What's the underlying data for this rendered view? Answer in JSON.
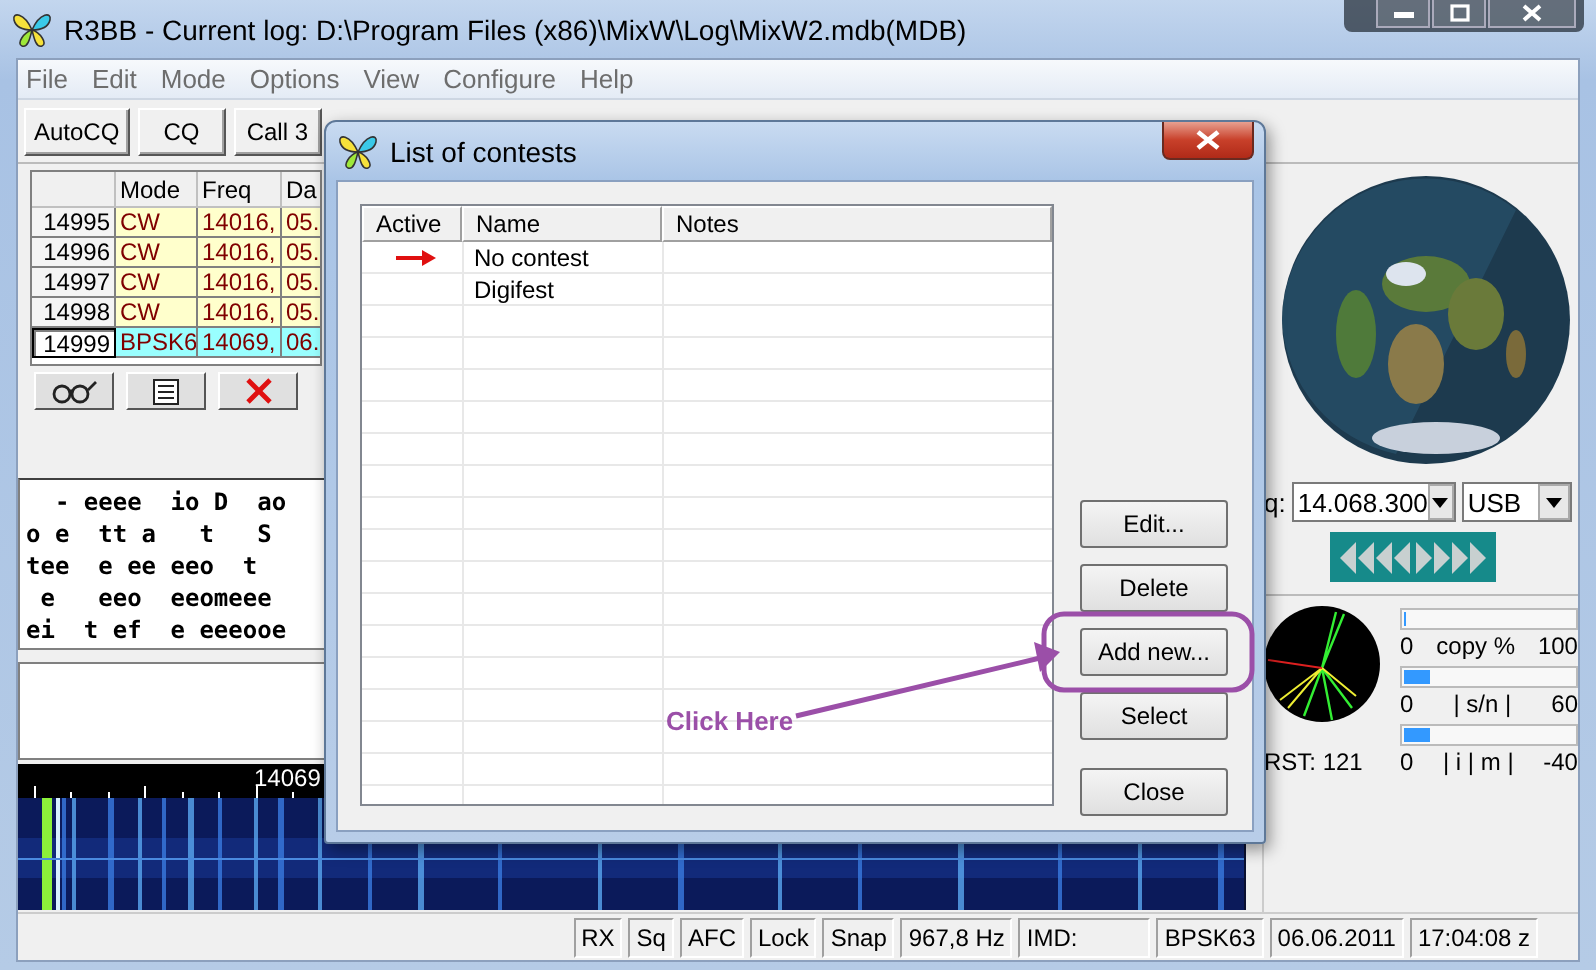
{
  "window": {
    "title": "R3BB - Current log: D:\\Program Files (x86)\\MixW\\Log\\MixW2.mdb(MDB)"
  },
  "menu": [
    "File",
    "Edit",
    "Mode",
    "Options",
    "View",
    "Configure",
    "Help"
  ],
  "toolbar": [
    "AutoCQ",
    "CQ",
    "Call 3"
  ],
  "log": {
    "columns": [
      "Mode",
      "Freq",
      "Da"
    ],
    "rows": [
      {
        "number": "14995",
        "mode": "CW",
        "freq": "14016,",
        "date": "05.",
        "color": "#ffffcc",
        "selected": false
      },
      {
        "number": "14996",
        "mode": "CW",
        "freq": "14016,",
        "date": "05.",
        "color": "#ffffcc",
        "selected": false
      },
      {
        "number": "14997",
        "mode": "CW",
        "freq": "14016,",
        "date": "05.",
        "color": "#ffffcc",
        "selected": false
      },
      {
        "number": "14998",
        "mode": "CW",
        "freq": "14016,",
        "date": "05.",
        "color": "#ffffcc",
        "selected": false
      },
      {
        "number": "14999",
        "mode": "BPSK6",
        "freq": "14069,",
        "date": "06.",
        "color": "#99ffff",
        "selected": true
      }
    ]
  },
  "receive_text": [
    "  - eeee  io D  ao",
    "o e  tt a   t   S",
    "tee  e ee eeo  t",
    " e   eeo  eeomeee",
    "ei  t ef  e eeeooe"
  ],
  "waterfall": {
    "scale_label": "14069"
  },
  "right": {
    "freq_label": "q:",
    "frequency": "14.068.300",
    "sideband": "USB",
    "rst": "RST: 121",
    "meters": [
      {
        "min": "0",
        "label": "copy %",
        "max": "100",
        "level": 0
      },
      {
        "min": "0",
        "label": "| s/n |",
        "max": "60",
        "level": 0.15
      },
      {
        "min": "0",
        "label": "| i  | m |",
        "max": "-40",
        "level": 0.15
      }
    ]
  },
  "status_bar": [
    "RX",
    "Sq",
    "AFC",
    "Lock",
    "Snap",
    "967,8 Hz",
    "IMD:",
    "BPSK63",
    "06.06.2011",
    "17:04:08 z"
  ],
  "dialog": {
    "title": "List of contests",
    "columns": [
      "Active",
      "Name",
      "Notes"
    ],
    "rows": [
      {
        "active": true,
        "name": "No contest"
      },
      {
        "active": false,
        "name": "Digifest"
      }
    ],
    "buttons": [
      "Edit...",
      "Delete",
      "Add new...",
      "Select",
      "Close"
    ]
  },
  "annotation": {
    "text": "Click Here"
  }
}
